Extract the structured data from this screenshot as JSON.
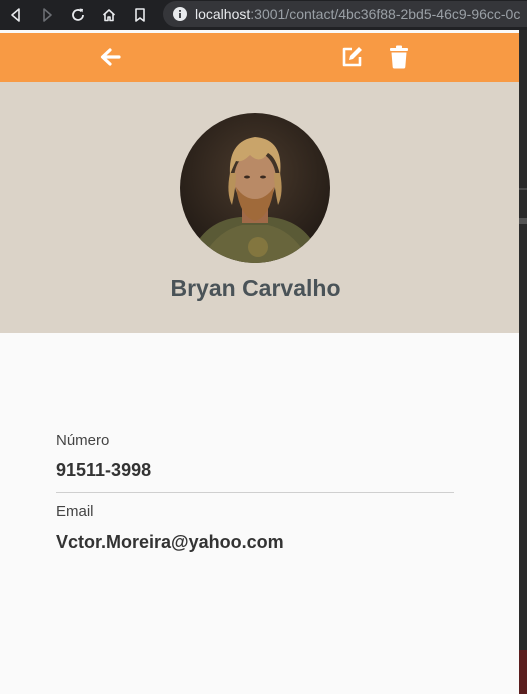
{
  "browser": {
    "url_host": "localhost",
    "url_rest": ":3001/contact/4bc36f88-2bd5-46c9-96cc-0c"
  },
  "icons": {
    "back": "arrow-left-icon",
    "edit": "edit-icon",
    "delete": "trash-icon"
  },
  "colors": {
    "header": "#f89a44",
    "profile_bg": "#dbd3c8",
    "name": "#4a5358"
  },
  "contact": {
    "name": "Bryan Carvalho",
    "phone_label": "Número",
    "phone": "91511-3998",
    "email_label": "Email",
    "email": "Vctor.Moreira@yahoo.com"
  }
}
